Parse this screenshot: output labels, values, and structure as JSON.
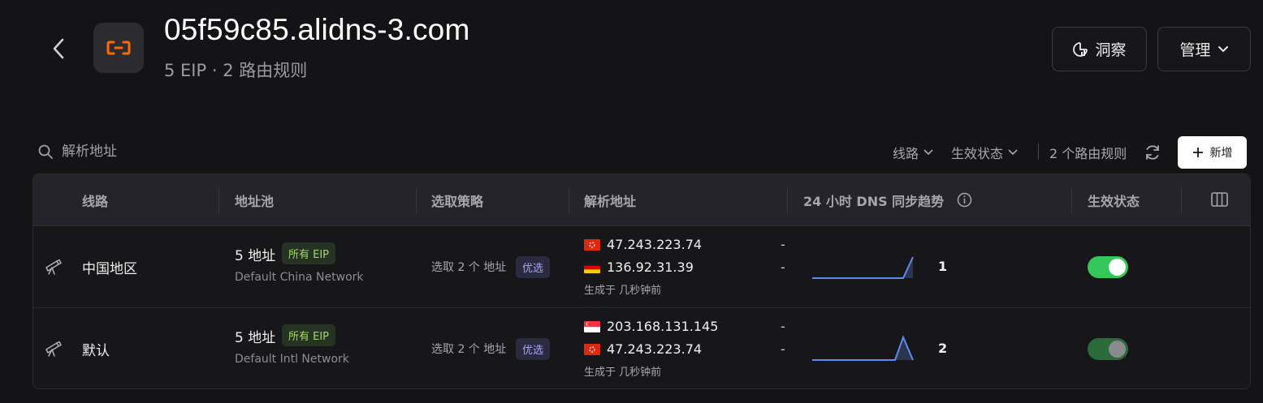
{
  "header": {
    "title": "05f59c85.alidns-3.com",
    "subtitle": "5 EIP · 2 路由规则",
    "insight_label": "洞察",
    "manage_label": "管理"
  },
  "toolbar": {
    "search_placeholder": "解析地址",
    "filter_route": "线路",
    "filter_status": "生效状态",
    "count_label": "2 个路由规则",
    "add_label": "新增"
  },
  "table": {
    "columns": [
      "线路",
      "地址池",
      "选取策略",
      "解析地址",
      "24 小时 DNS 同步趋势",
      "生效状态"
    ],
    "rows": [
      {
        "route": "中国地区",
        "pool_count": "5 地址",
        "pool_tag": "所有 EIP",
        "pool_network": "Default China Network",
        "strategy": "选取 2 个 地址",
        "strategy_tag": "优选",
        "ips": [
          {
            "flag": "hk",
            "ip": "47.243.223.74",
            "dash": "-"
          },
          {
            "flag": "de",
            "ip": "136.92.31.39",
            "dash": "-"
          }
        ],
        "generated": "生成于 几秒钟前",
        "trend_value": "1",
        "enabled": true
      },
      {
        "route": "默认",
        "pool_count": "5 地址",
        "pool_tag": "所有 EIP",
        "pool_network": "Default Intl Network",
        "strategy": "选取 2 个 地址",
        "strategy_tag": "优选",
        "ips": [
          {
            "flag": "sg",
            "ip": "203.168.131.145",
            "dash": "-"
          },
          {
            "flag": "hk",
            "ip": "47.243.223.74",
            "dash": "-"
          }
        ],
        "generated": "生成于 几秒钟前",
        "trend_value": "2",
        "enabled": true
      }
    ]
  },
  "colors": {
    "background": "#141417",
    "accent_logo": "#ff6a00",
    "toggle_on": "#34c759",
    "sparkline": "#5b8def"
  },
  "icons": [
    "back-icon",
    "alicloud-logo-icon",
    "insight-icon",
    "chevron-down-icon",
    "search-icon",
    "refresh-icon",
    "plus-icon",
    "telescope-icon",
    "info-icon",
    "columns-icon"
  ]
}
